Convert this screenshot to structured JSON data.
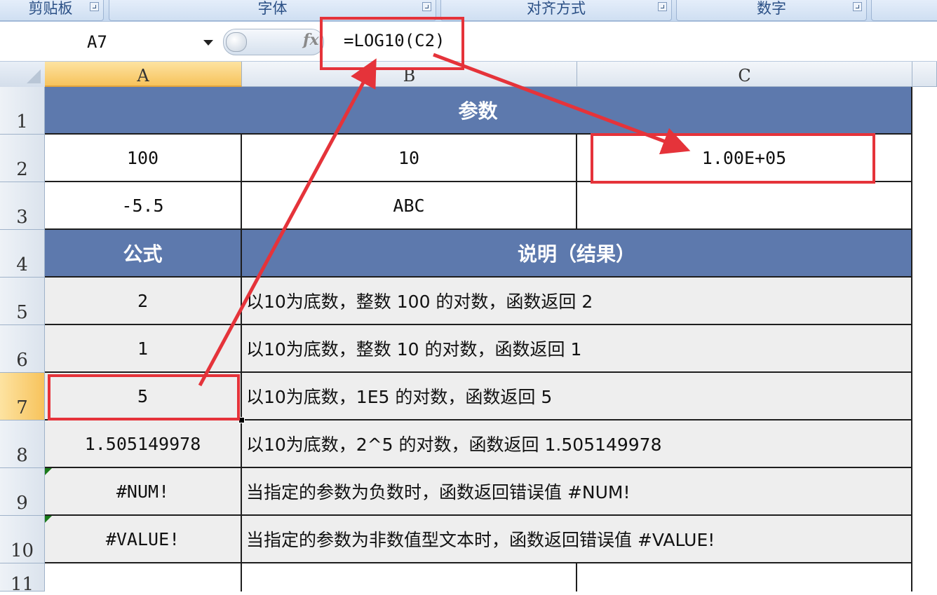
{
  "ribbon": {
    "groups": [
      "剪贴板",
      "字体",
      "对齐方式",
      "数字",
      ""
    ]
  },
  "formula_bar": {
    "name_box": "A7",
    "fx_label": "fx",
    "formula": "=LOG10(C2)"
  },
  "columns": [
    "A",
    "B",
    "C"
  ],
  "rows": [
    "1",
    "2",
    "3",
    "4",
    "5",
    "6",
    "7",
    "8",
    "9",
    "10",
    "11"
  ],
  "active_cell": {
    "column": "A",
    "row": "7"
  },
  "sheet": {
    "param_header": "参数",
    "r2": {
      "a": "100",
      "b": "10",
      "c": "1.00E+05"
    },
    "r3": {
      "a": "-5.5",
      "b": "ABC",
      "c": ""
    },
    "formula_header": "公式",
    "desc_header": "说明（结果）",
    "results": [
      {
        "formula": "2",
        "desc": "以10为底数，整数 100 的对数，函数返回 2"
      },
      {
        "formula": "1",
        "desc": "以10为底数，整数 10 的对数，函数返回 1"
      },
      {
        "formula": "5",
        "desc": "以10为底数，1E5 的对数，函数返回 5"
      },
      {
        "formula": "1.505149978",
        "desc": "以10为底数，2^5 的对数，函数返回 1.505149978"
      },
      {
        "formula": "#NUM!",
        "desc": "当指定的参数为负数时，函数返回错误值 #NUM!"
      },
      {
        "formula": "#VALUE!",
        "desc": "当指定的参数为非数值型文本时，函数返回错误值 #VALUE!"
      }
    ]
  },
  "colors": {
    "header_fill": "#5d79ad",
    "annotation_red": "#e5333a",
    "shade_fill": "#eeeeee"
  }
}
